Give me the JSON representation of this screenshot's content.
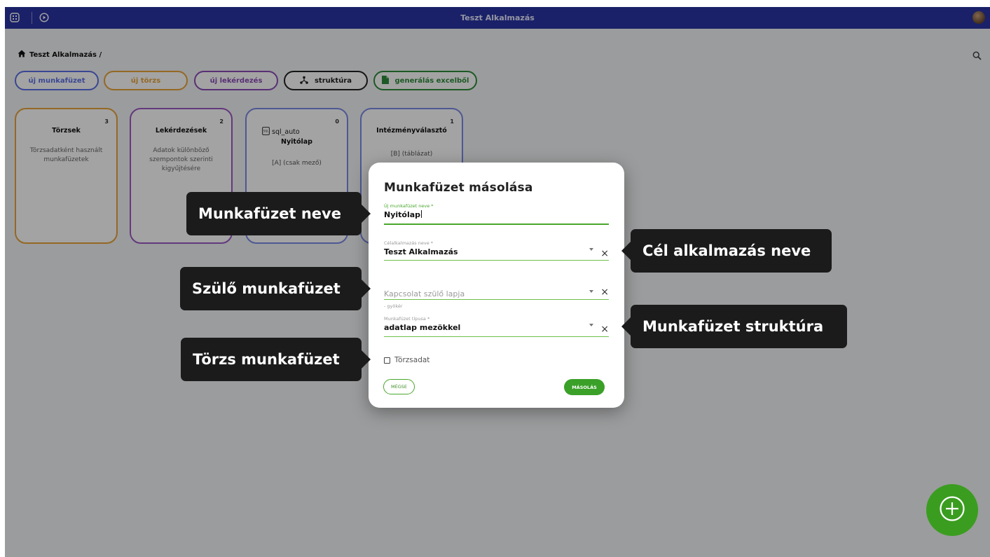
{
  "app": {
    "title": "Teszt Alkalmazás"
  },
  "breadcrumb": {
    "label": "Teszt Alkalmazás /"
  },
  "actions": [
    {
      "label": "új munkafüzet",
      "color": "#5b6fe6"
    },
    {
      "label": "új törzs",
      "color": "#e8a33a"
    },
    {
      "label": "új lekérdezés",
      "color": "#8a4bb8"
    },
    {
      "label": "struktúra",
      "color": "#222222"
    },
    {
      "label": "generálás excelből",
      "color": "#2e8b3a"
    }
  ],
  "cards": [
    {
      "count": "3",
      "title": "Törzsek",
      "description": "Törzsadatként használt munkafüzetek",
      "color": "#e8a33a"
    },
    {
      "count": "2",
      "title": "Lekérdezések",
      "description": "Adatok különböző szempontok szerinti kigyűjtésére",
      "color": "#9b59c4"
    },
    {
      "count": "0",
      "title": "sql_auto",
      "subtitle": "Nyitólap",
      "detail": "[A] (csak mező)",
      "color": "#7b8ae6"
    },
    {
      "count": "1",
      "title": "Intézményválasztó",
      "detail": "[B] (táblázat)",
      "color": "#7b8ae6"
    }
  ],
  "dialog": {
    "title": "Munkafüzet másolása",
    "name_field": {
      "label": "Új munkafüzet neve *",
      "value": "Nyitólap"
    },
    "target_field": {
      "label": "Célalkalmazás neve *",
      "value": "Teszt Alkalmazás"
    },
    "parent_field": {
      "placeholder": "Kapcsolat szülő lapja",
      "hint": "- gyökér"
    },
    "type_field": {
      "label": "Munkafüzet típusa *",
      "value": "adatlap mezökkel"
    },
    "master_checkbox": {
      "label": "Törzsadat",
      "checked": false
    },
    "cancel_label": "MÉGSE",
    "copy_label": "MÁSOLÁS"
  },
  "callouts": {
    "name": "Munkafüzet neve",
    "target": "Cél alkalmazás neve",
    "parent": "Szülő munkafüzet",
    "type": "Munkafüzet struktúra",
    "master": "Törzs munkafüzet"
  },
  "colors": {
    "topbar": "#2a34a3",
    "accent_green": "#3aa028",
    "fab": "#3a9d1f"
  }
}
